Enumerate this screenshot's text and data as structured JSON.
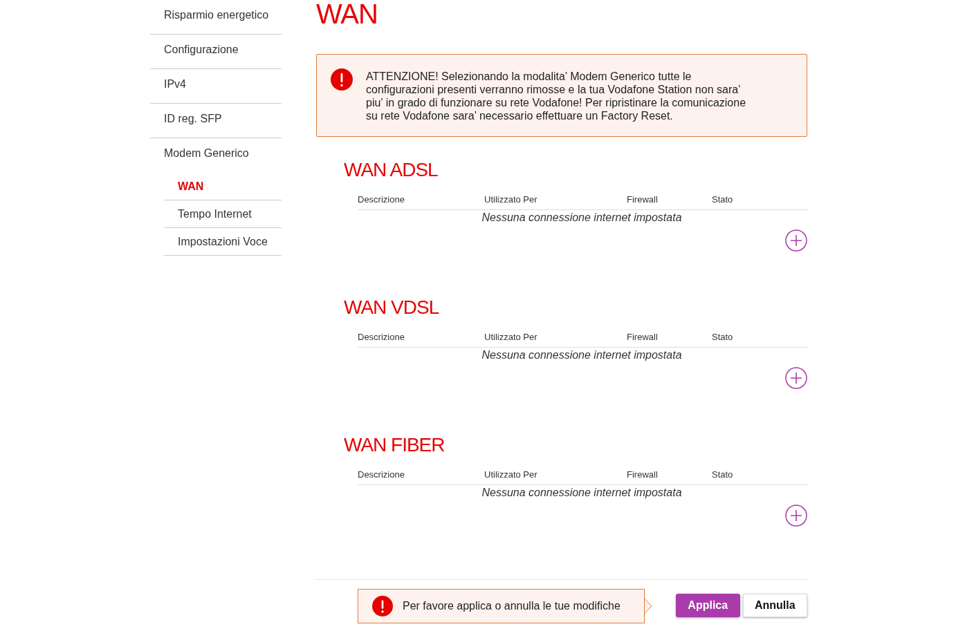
{
  "sidebar": {
    "items": [
      {
        "label": "Risparmio energetico",
        "selected": false
      },
      {
        "label": "Configurazione",
        "selected": false
      },
      {
        "label": "IPv4",
        "selected": false
      },
      {
        "label": "ID reg. SFP",
        "selected": false
      },
      {
        "label": "Modem Generico",
        "selected": false,
        "children": [
          {
            "label": "WAN",
            "selected": true
          },
          {
            "label": "Tempo Internet",
            "selected": false
          },
          {
            "label": "Impostazioni Voce",
            "selected": false
          }
        ]
      }
    ]
  },
  "page_title": "WAN",
  "warning": {
    "lines": [
      "ATTENZIONE! Selezionando la modalita’ Modem Generico tutte le",
      "configurazioni presenti verranno rimosse e la tua Vodafone Station non sara’",
      "piu’ in grado di funzionare su rete Vodafone! Per ripristinare la comunicazione",
      "su rete Vodafone sara’ necessario effettuare un Factory Reset."
    ]
  },
  "sections": [
    {
      "title": "WAN ADSL",
      "columns": [
        "Descrizione",
        "Utilizzato Per",
        "Firewall",
        "Stato"
      ],
      "empty_message": "Nessuna connessione internet impostata"
    },
    {
      "title": "WAN VDSL",
      "columns": [
        "Descrizione",
        "Utilizzato Per",
        "Firewall",
        "Stato"
      ],
      "empty_message": "Nessuna connessione internet impostata"
    },
    {
      "title": "WAN FIBER",
      "columns": [
        "Descrizione",
        "Utilizzato Per",
        "Firewall",
        "Stato"
      ],
      "empty_message": "Nessuna connessione internet impostata"
    }
  ],
  "footer": {
    "notice": "Per favore applica o annulla le tue modifiche",
    "buttons": [
      {
        "label": "Applica",
        "kind": "primary"
      },
      {
        "label": "Annulla",
        "kind": "secondary"
      }
    ]
  }
}
